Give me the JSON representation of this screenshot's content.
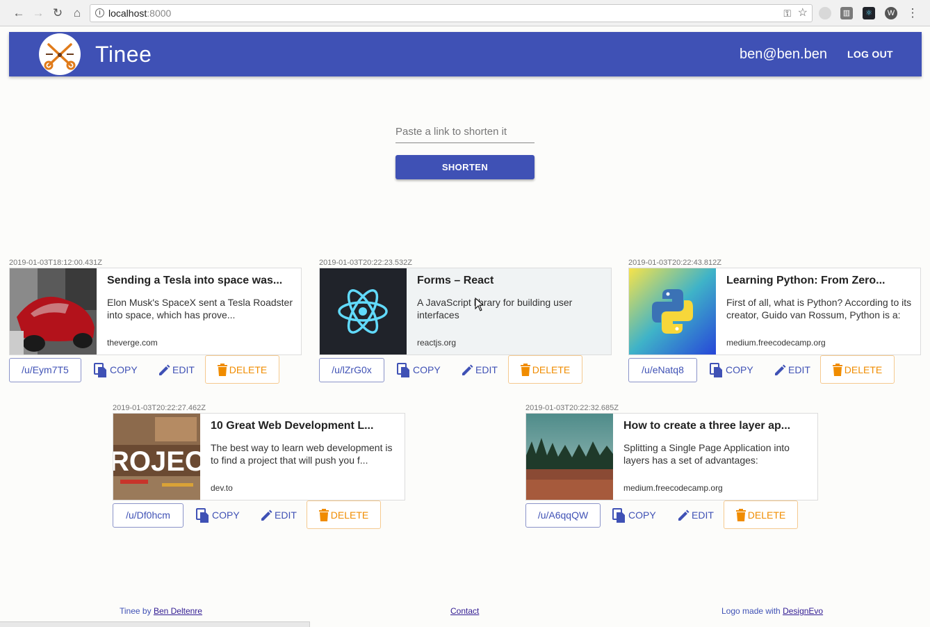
{
  "browser": {
    "url_host": "localhost",
    "url_port": ":8000"
  },
  "header": {
    "title": "Tinee",
    "user_email": "ben@ben.ben",
    "logout_label": "LOG OUT",
    "brand_color": "#3f51b5"
  },
  "shorten": {
    "placeholder": "Paste a link to shorten it",
    "value": "",
    "button_label": "SHORTEN"
  },
  "links": [
    {
      "timestamp": "2019-01-03T18:12:00.431Z",
      "title": "Sending a Tesla into space was...",
      "description": "Elon Musk's SpaceX sent a Tesla Roadster into space, which has prove...",
      "domain": "theverge.com",
      "short_url": "/u/Eym7T5",
      "copy_label": "COPY",
      "edit_label": "EDIT",
      "delete_label": "DELETE"
    },
    {
      "timestamp": "2019-01-03T20:22:23.532Z",
      "title": "Forms – React",
      "description": "A JavaScript library for building user interfaces",
      "domain": "reactjs.org",
      "short_url": "/u/lZrG0x",
      "copy_label": "COPY",
      "edit_label": "EDIT",
      "delete_label": "DELETE"
    },
    {
      "timestamp": "2019-01-03T20:22:43.812Z",
      "title": "Learning Python: From Zero...",
      "description": "First of all, what is Python? According to its creator, Guido van Rossum, Python is a:",
      "domain": "medium.freecodecamp.org",
      "short_url": "/u/eNatq8",
      "copy_label": "COPY",
      "edit_label": "EDIT",
      "delete_label": "DELETE"
    },
    {
      "timestamp": "2019-01-03T20:22:27.462Z",
      "title": "10 Great Web Development L...",
      "description": "The best way to learn web development is to find a project that will push you f...",
      "domain": "dev.to",
      "short_url": "/u/Df0hcm",
      "copy_label": "COPY",
      "edit_label": "EDIT",
      "delete_label": "DELETE",
      "thumb_text": "ROJEC"
    },
    {
      "timestamp": "2019-01-03T20:22:32.685Z",
      "title": "How to create a three layer ap...",
      "description": "Splitting a Single Page Application into layers has a set of advantages:",
      "domain": "medium.freecodecamp.org",
      "short_url": "/u/A6qqQW",
      "copy_label": "COPY",
      "edit_label": "EDIT",
      "delete_label": "DELETE"
    }
  ],
  "footer": {
    "credit_prefix": "Tinee by",
    "credit_link": "Ben Deltenre",
    "contact": "Contact",
    "logo_prefix": "Logo made with",
    "logo_link": "DesignEvo"
  }
}
